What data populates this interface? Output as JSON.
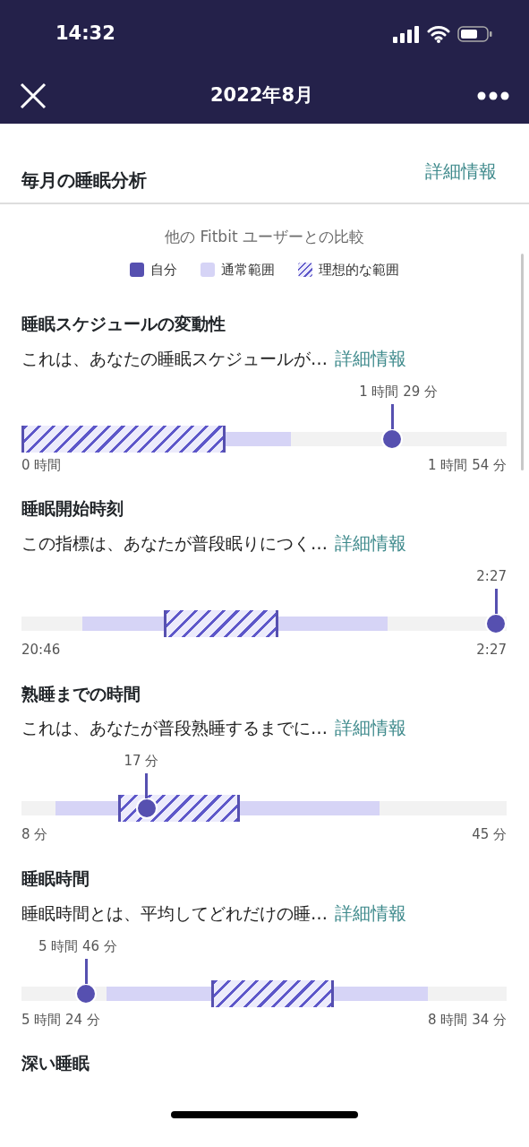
{
  "status_bar": {
    "time": "14:32"
  },
  "header": {
    "title": "2022年8月"
  },
  "section": {
    "title": "毎月の睡眠分析",
    "link": "詳細情報"
  },
  "comparison": {
    "subtitle": "他の Fitbit ユーザーとの比較",
    "legend": [
      {
        "kind": "dot",
        "label": "自分"
      },
      {
        "kind": "band",
        "label": "通常範囲"
      },
      {
        "kind": "hatched",
        "label": "理想的な範囲"
      }
    ]
  },
  "metrics": [
    {
      "title": "睡眠スケジュールの変動性",
      "description": "これは、あなたの睡眠スケジュールが…",
      "link": "詳細情報",
      "value": "1 時間 29 分",
      "min": "0 時間",
      "max": "1 時間 54 分",
      "level": 0.777
    },
    {
      "title": "睡眠開始時刻",
      "description": "この指標は、あなたが普段眠りにつく…",
      "link": "詳細情報",
      "value": "2:27",
      "min": "20:46",
      "max": "2:27",
      "level": 1.0
    },
    {
      "title": "熟睡までの時間",
      "description": "これは、あなたが普段熟睡するまでに…",
      "link": "詳細情報",
      "value": "17 分",
      "min": "8 分",
      "max": "45 分",
      "level": 0.247
    },
    {
      "title": "睡眠時間",
      "description": "睡眠時間とは、平均してどれだけの睡…",
      "link": "詳細情報",
      "value": "5 時間 46 分",
      "min": "5 時間 24 分",
      "max": "8 時間 34 分",
      "level": 0.116
    }
  ],
  "next_section": {
    "title": "深い睡眠"
  }
}
